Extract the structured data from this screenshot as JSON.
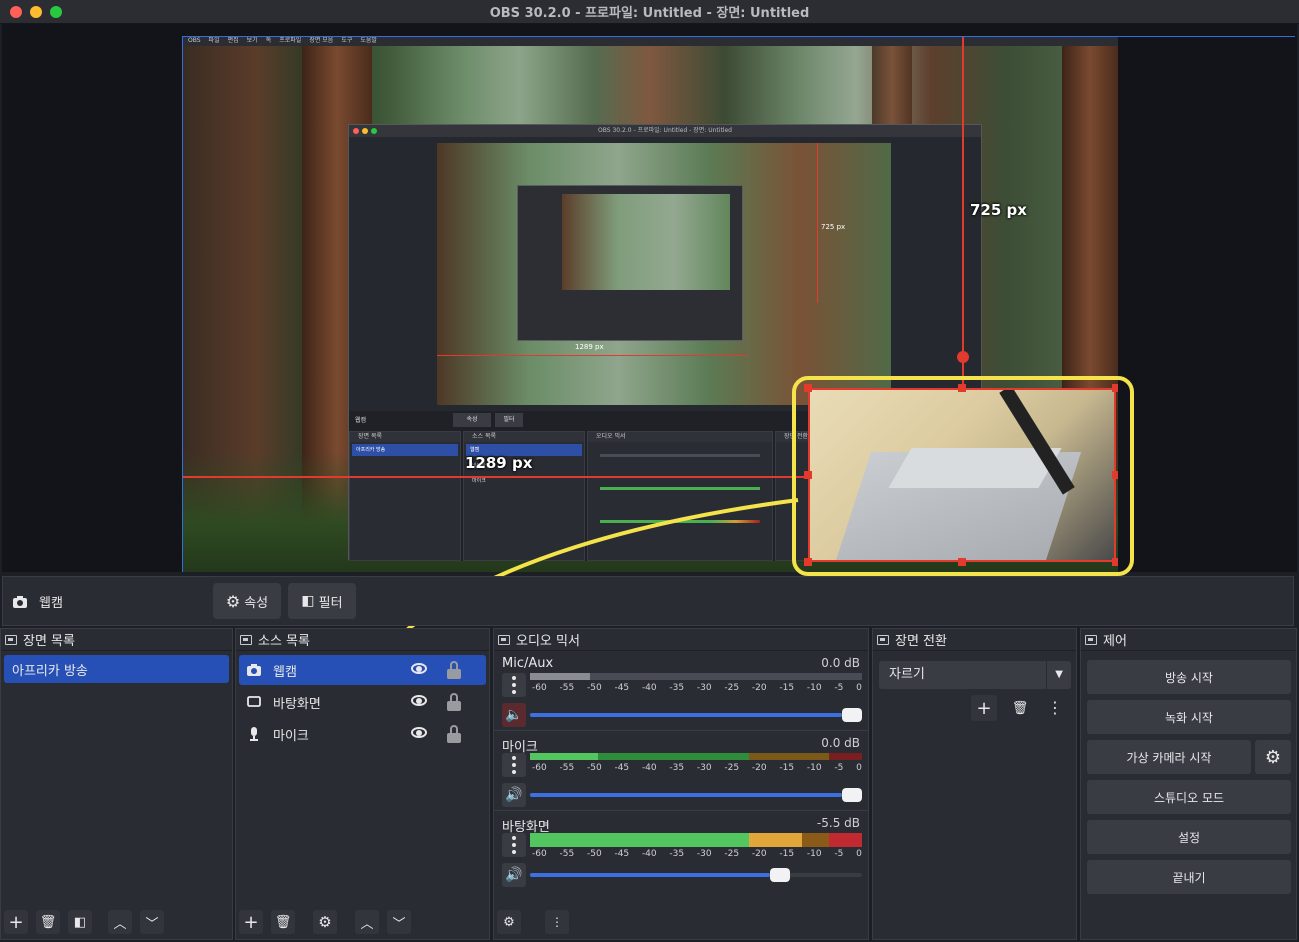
{
  "window": {
    "title": "OBS 30.2.0 - 프로파일: Untitled - 장면: Untitled"
  },
  "preview": {
    "nested_title": "OBS 30.2.0 - 프로파일: Untitled - 장면: Untitled",
    "nested_menu": [
      "OBS",
      "파일",
      "편집",
      "보기",
      "독",
      "프로파일",
      "장면 모음",
      "도구",
      "도움말"
    ],
    "measure_v": "725 px",
    "measure_h": "1289 px",
    "nested_measure_v": "725 px",
    "nested_measure_h": "1289 px",
    "nested_source": "웹캠",
    "nested_props": "속성",
    "nested_filters": "필터",
    "nested_docks": [
      "장면 목록",
      "소스 목록",
      "오디오 믹서",
      "장면 전환"
    ],
    "nested_scene": "아프리카 방송",
    "nested_sources": [
      "웹캠",
      "바탕화면",
      "마이크"
    ]
  },
  "toolbar": {
    "source_name": "웹캠",
    "properties_label": "속성",
    "filters_label": "필터"
  },
  "scenes": {
    "title": "장면 목록",
    "items": [
      "아프리카 방송"
    ]
  },
  "sources": {
    "title": "소스 목록",
    "items": [
      {
        "name": "웹캠",
        "icon": "camera-icon"
      },
      {
        "name": "바탕화면",
        "icon": "monitor-icon"
      },
      {
        "name": "마이크",
        "icon": "microphone-icon"
      }
    ]
  },
  "mixer": {
    "title": "오디오 믹서",
    "ticks": [
      "-60",
      "-55",
      "-50",
      "-45",
      "-40",
      "-35",
      "-30",
      "-25",
      "-20",
      "-15",
      "-10",
      "-5",
      "0"
    ],
    "channels": [
      {
        "name": "Mic/Aux",
        "db": "0.0 dB",
        "muted": true,
        "volume": 1.0
      },
      {
        "name": "마이크",
        "db": "0.0 dB",
        "muted": false,
        "volume": 1.0
      },
      {
        "name": "바탕화면",
        "db": "-5.5 dB",
        "muted": false,
        "volume": 0.75
      }
    ]
  },
  "transitions": {
    "title": "장면 전환",
    "selected": "자르기"
  },
  "controls": {
    "title": "제어",
    "buttons": [
      "방송 시작",
      "녹화 시작",
      "가상 카메라 시작",
      "스튜디오 모드",
      "설정",
      "끝내기"
    ]
  },
  "colors": {
    "accent": "#2750b6",
    "guide": "#e23a2c",
    "highlight": "#f4e34a",
    "panel": "#2a2c33"
  }
}
